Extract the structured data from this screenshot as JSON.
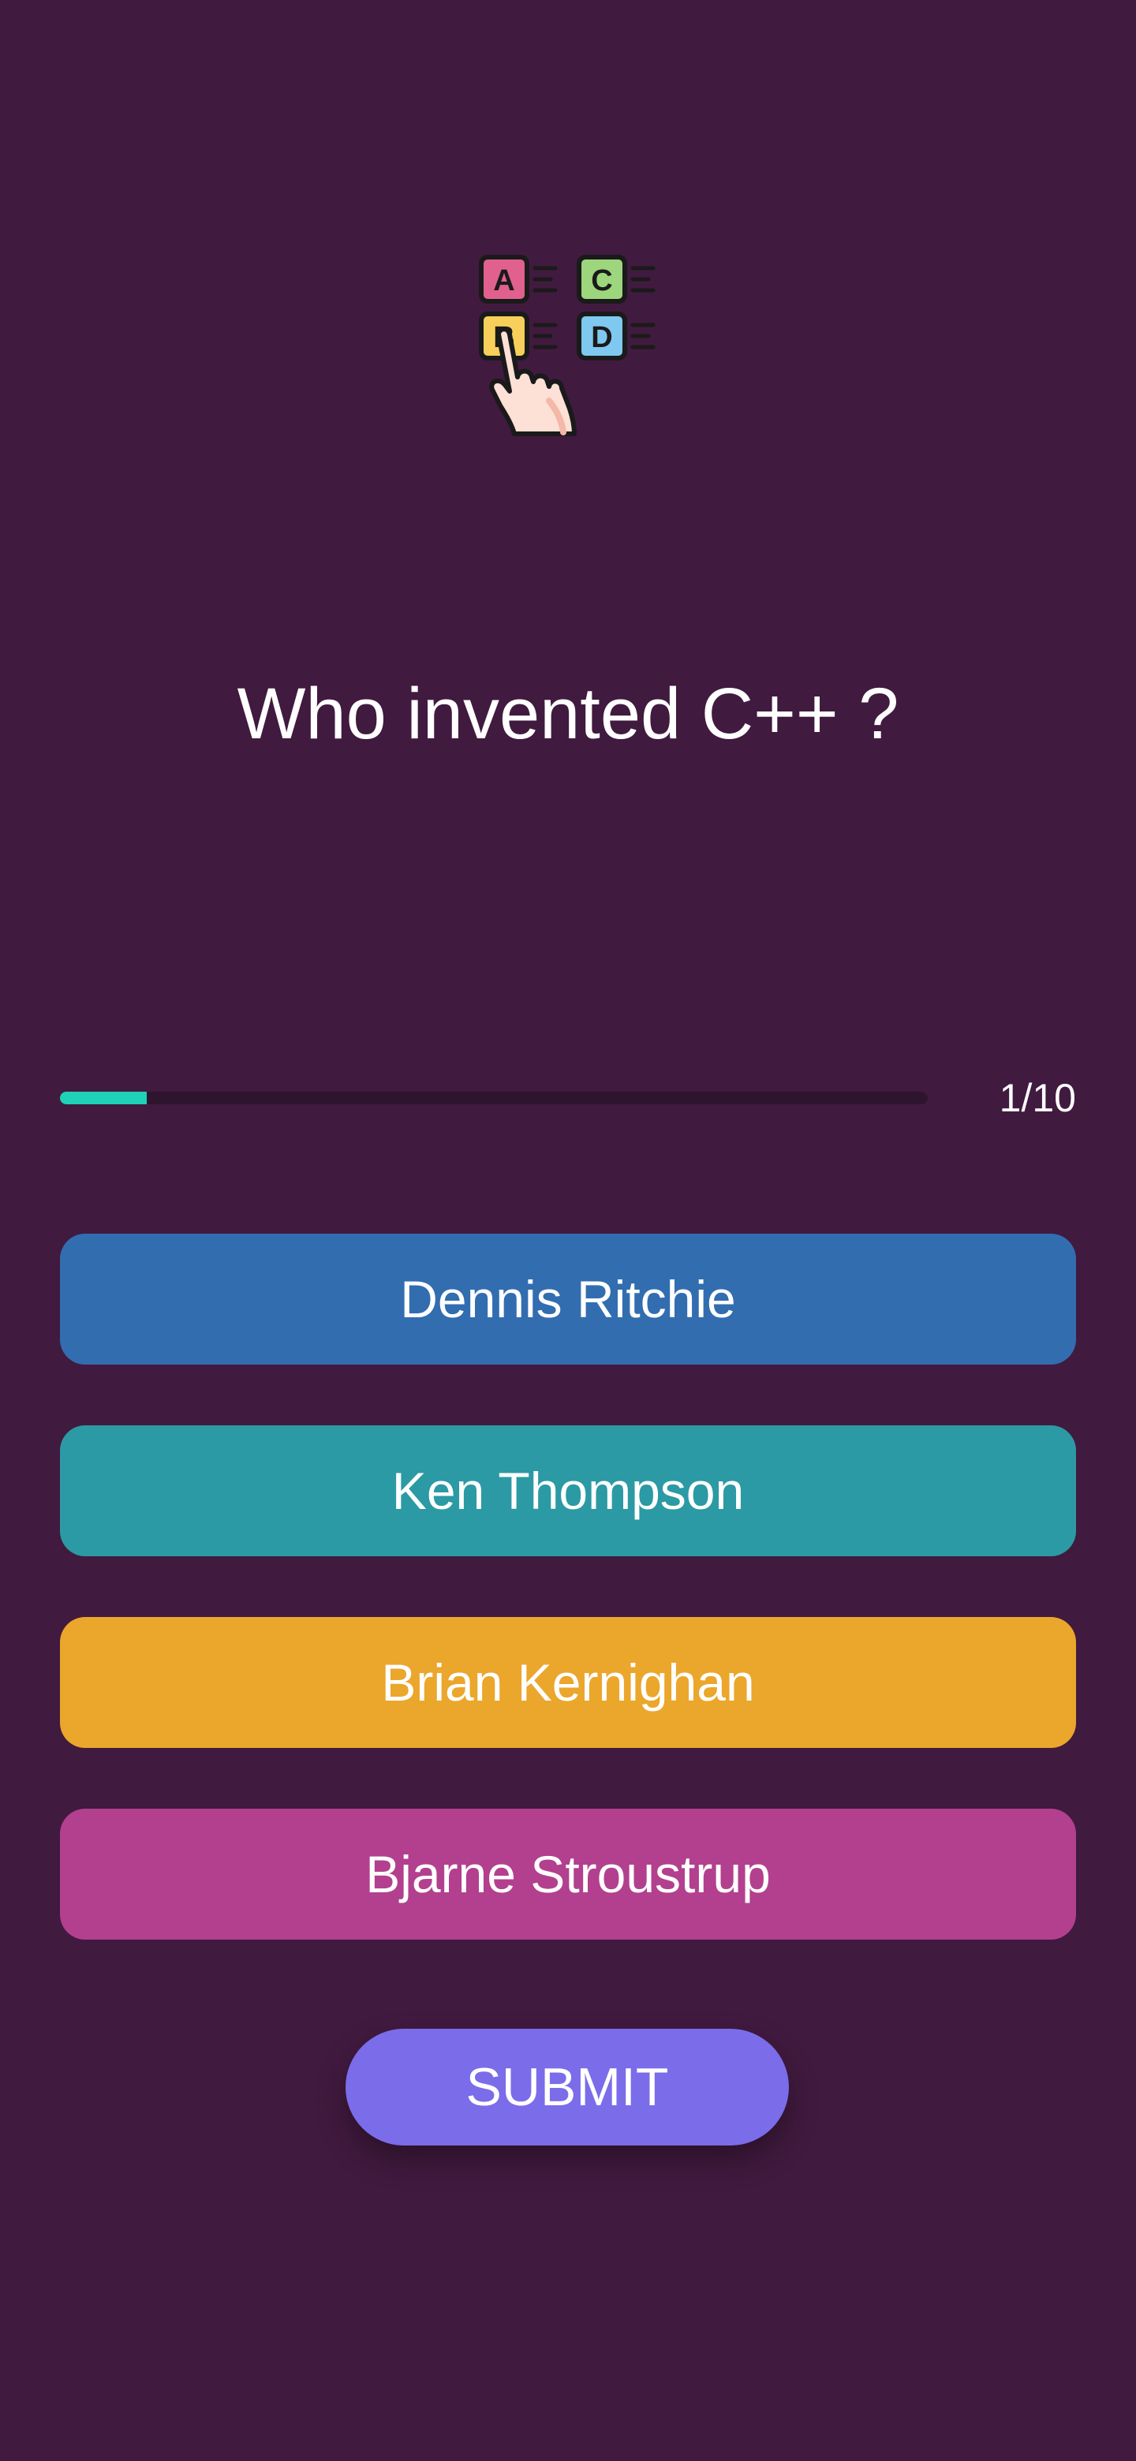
{
  "quiz": {
    "icon": "abcd-options-hand-pointer-icon",
    "question": "Who invented C++ ?",
    "progress": {
      "current": 1,
      "total": 10,
      "label": "1/10",
      "fraction": 0.1
    },
    "answers": [
      {
        "label": "Dennis Ritchie",
        "color": "#326db0"
      },
      {
        "label": "Ken Thompson",
        "color": "#2b9aa4"
      },
      {
        "label": "Brian Kernighan",
        "color": "#eba62c"
      },
      {
        "label": "Bjarne Stroustrup",
        "color": "#b2408e"
      }
    ],
    "submit_label": "SUBMIT"
  },
  "colors": {
    "background": "#411a3f",
    "progress_track": "#2f1430",
    "progress_fill": "#1fd1b6",
    "submit": "#7b6ce9",
    "text": "#ffffff"
  }
}
